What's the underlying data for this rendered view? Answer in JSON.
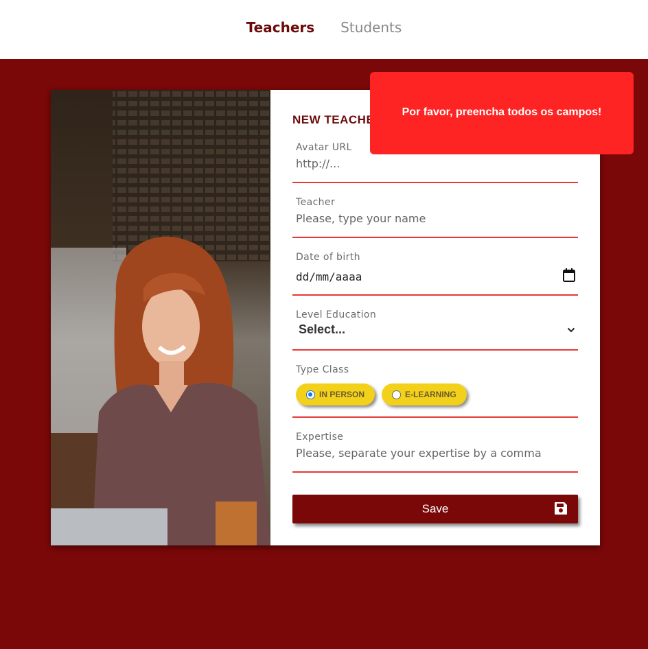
{
  "nav": {
    "teachers_label": "Teachers",
    "students_label": "Students"
  },
  "form": {
    "title": "NEW TEACHER",
    "avatar": {
      "label": "Avatar URL",
      "placeholder": "http://..."
    },
    "teacher": {
      "label": "Teacher",
      "placeholder": "Please, type your name"
    },
    "dob": {
      "label": "Date of birth",
      "value": "dd/mm/aaaa"
    },
    "education": {
      "label": "Level Education",
      "selected": "Select..."
    },
    "type_class": {
      "label": "Type Class",
      "options": [
        "IN PERSON",
        "E-LEARNING"
      ],
      "checked": "IN PERSON"
    },
    "expertise": {
      "label": "Expertise",
      "placeholder": "Please, separate your expertise by a comma"
    },
    "save_label": "Save"
  },
  "toast": {
    "message": "Por favor, preencha todos os campos!"
  },
  "colors": {
    "brand": "#7a0808",
    "underline": "#e53935",
    "pill": "#f3d11a",
    "toast": "#ff2424"
  },
  "icons": [
    "calendar-icon",
    "chevron-down-icon",
    "save-icon"
  ]
}
